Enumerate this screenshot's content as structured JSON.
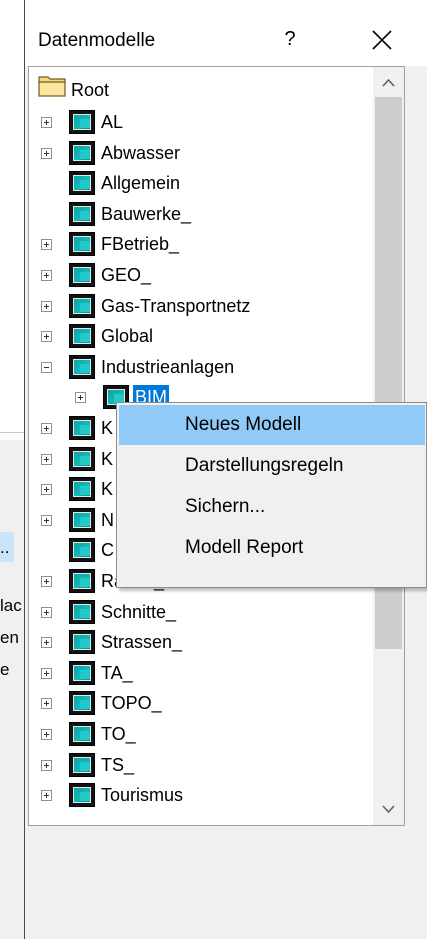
{
  "background_window": {
    "fragments": [
      "..",
      "lac",
      "en",
      "e"
    ]
  },
  "dialog": {
    "title": "Datenmodelle",
    "help_label": "?",
    "tree": {
      "root_label": "Root",
      "items": [
        {
          "label": "AL",
          "expander": "plus"
        },
        {
          "label": "Abwasser",
          "expander": "plus"
        },
        {
          "label": "Allgemein",
          "expander": "none"
        },
        {
          "label": "Bauwerke_",
          "expander": "none"
        },
        {
          "label": "FBetrieb_",
          "expander": "plus"
        },
        {
          "label": "GEO_",
          "expander": "plus"
        },
        {
          "label": "Gas-Transportnetz",
          "expander": "plus"
        },
        {
          "label": "Global",
          "expander": "plus"
        },
        {
          "label": "Industrieanlagen",
          "expander": "minus"
        },
        {
          "label": "BIM",
          "expander": "plus",
          "level": 2,
          "selected": true
        },
        {
          "label": "K",
          "expander": "plus"
        },
        {
          "label": "K",
          "expander": "plus"
        },
        {
          "label": "K",
          "expander": "plus"
        },
        {
          "label": "N",
          "expander": "plus"
        },
        {
          "label": "C",
          "expander": "none"
        },
        {
          "label": "Raster_",
          "expander": "plus"
        },
        {
          "label": "Schnitte_",
          "expander": "plus"
        },
        {
          "label": "Strassen_",
          "expander": "plus"
        },
        {
          "label": "TA_",
          "expander": "plus"
        },
        {
          "label": "TOPO_",
          "expander": "plus"
        },
        {
          "label": "TO_",
          "expander": "plus"
        },
        {
          "label": "TS_",
          "expander": "plus"
        },
        {
          "label": "Tourismus",
          "expander": "plus"
        }
      ]
    }
  },
  "context_menu": {
    "items": [
      {
        "label": "Neues Modell",
        "highlighted": true
      },
      {
        "label": "Darstellungsregeln",
        "highlighted": false
      },
      {
        "label": "Sichern...",
        "highlighted": false
      },
      {
        "label": "Modell Report",
        "highlighted": false
      }
    ]
  },
  "colors": {
    "selection": "#0078d7",
    "menu_highlight": "#91c9f7",
    "icon_teal": "#15b7b7"
  }
}
